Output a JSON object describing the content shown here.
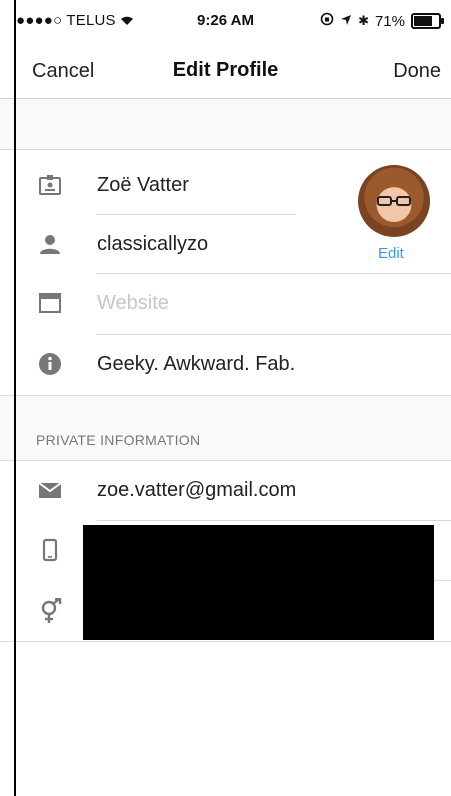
{
  "status_bar": {
    "carrier": "●●●●○ TELUS",
    "wifi": "wifi-icon",
    "time": "9:26 AM",
    "battery_percent": "71%",
    "battery_level": 0.71
  },
  "nav": {
    "cancel_label": "Cancel",
    "title": "Edit Profile",
    "done_label": "Done"
  },
  "profile": {
    "name": "Zoë Vatter",
    "username": "classicallyzo",
    "website_placeholder": "Website",
    "bio": "Geeky. Awkward. Fab.",
    "avatar_edit_label": "Edit"
  },
  "private": {
    "header": "PRIVATE INFORMATION",
    "email": "zoe.vatter@gmail.com"
  },
  "colors": {
    "accent": "#3897f0",
    "icon_gray": "#777777",
    "placeholder": "#c7c7c7"
  }
}
